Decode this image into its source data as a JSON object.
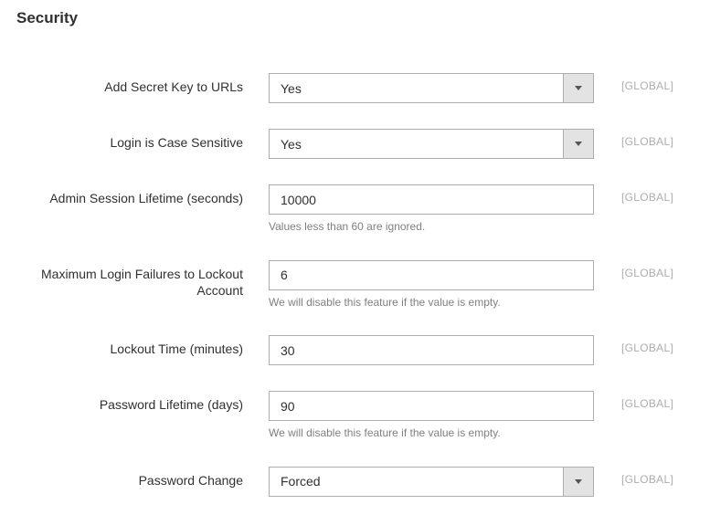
{
  "section_title": "Security",
  "fields": {
    "secret_key": {
      "label": "Add Secret Key to URLs",
      "value": "Yes",
      "scope": "[GLOBAL]"
    },
    "case_sensitive": {
      "label": "Login is Case Sensitive",
      "value": "Yes",
      "scope": "[GLOBAL]"
    },
    "session_lifetime": {
      "label": "Admin Session Lifetime (seconds)",
      "value": "10000",
      "note": "Values less than 60 are ignored.",
      "scope": "[GLOBAL]"
    },
    "max_failures": {
      "label": "Maximum Login Failures to Lockout Account",
      "value": "6",
      "note": "We will disable this feature if the value is empty.",
      "scope": "[GLOBAL]"
    },
    "lockout_time": {
      "label": "Lockout Time (minutes)",
      "value": "30",
      "scope": "[GLOBAL]"
    },
    "password_lifetime": {
      "label": "Password Lifetime (days)",
      "value": "90",
      "note": "We will disable this feature if the value is empty.",
      "scope": "[GLOBAL]"
    },
    "password_change": {
      "label": "Password Change",
      "value": "Forced",
      "scope": "[GLOBAL]"
    }
  }
}
